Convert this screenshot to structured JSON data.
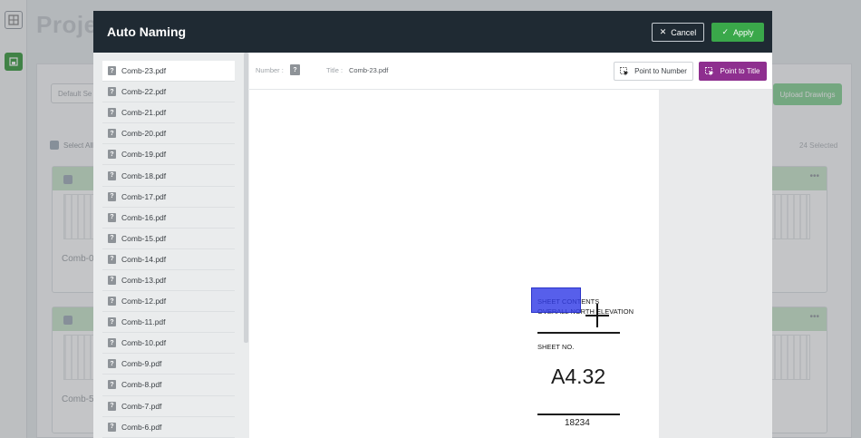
{
  "background": {
    "title": "Proje",
    "default_select": "Default Se",
    "upload_label": "Upload Drawings",
    "select_all": "Select All",
    "selected_count": "24 Selected",
    "cards": [
      "Comb-0",
      "Comb-5"
    ]
  },
  "modal": {
    "title": "Auto Naming",
    "cancel_label": "Cancel",
    "apply_label": "Apply"
  },
  "toolbar": {
    "number_label": "Number :",
    "number_value": "?",
    "title_label": "Title :",
    "title_value": "Comb-23.pdf",
    "point_number_label": "Point to Number",
    "point_title_label": "Point to Title"
  },
  "files": [
    "Comb-23.pdf",
    "Comb-22.pdf",
    "Comb-21.pdf",
    "Comb-20.pdf",
    "Comb-19.pdf",
    "Comb-18.pdf",
    "Comb-17.pdf",
    "Comb-16.pdf",
    "Comb-15.pdf",
    "Comb-14.pdf",
    "Comb-13.pdf",
    "Comb-12.pdf",
    "Comb-11.pdf",
    "Comb-10.pdf",
    "Comb-9.pdf",
    "Comb-8.pdf",
    "Comb-7.pdf",
    "Comb-6.pdf"
  ],
  "file_icon_glyph": "?",
  "document": {
    "sheet_contents": "SHEET CONTENTS",
    "overall": "OVERALL NORTH ELEVATION",
    "sheet_no_label": "SHEET NO.",
    "sheet_number": "A4.32",
    "drawing_number": "18234"
  },
  "colors": {
    "header": "#1f2a33",
    "apply": "#3aa84a",
    "point_title": "#8e2f8f",
    "selection": "#3240e6"
  }
}
